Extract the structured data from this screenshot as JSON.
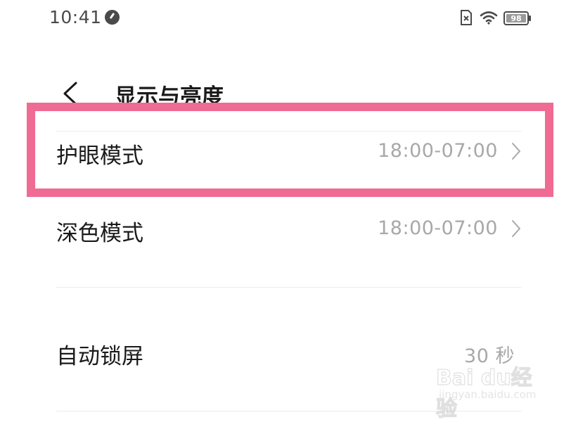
{
  "status_bar": {
    "time": "10:41",
    "battery": "98"
  },
  "header": {
    "title": "显示与亮度"
  },
  "rows": [
    {
      "label": "护眼模式",
      "value": "18:00-07:00",
      "has_chevron": true,
      "highlighted": true
    },
    {
      "label": "深色模式",
      "value": "18:00-07:00",
      "has_chevron": true
    },
    {
      "label": "自动锁屏",
      "value": "30 秒",
      "has_chevron": true
    }
  ],
  "highlight_color": "#ef6b93",
  "watermark": {
    "brand": "Bai du经验",
    "url": "jingyan.baidu.com"
  },
  "icons": [
    "status-indicator-icon",
    "sim-card-icon",
    "wifi-icon",
    "battery-icon",
    "back-icon",
    "chevron-right-icon"
  ]
}
